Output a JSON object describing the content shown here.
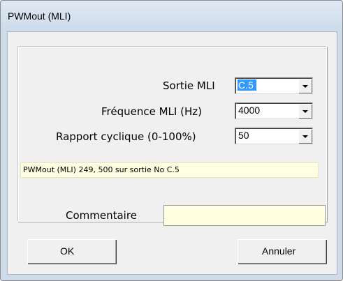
{
  "window": {
    "title": "PWMout (MLI)"
  },
  "form": {
    "output": {
      "label": "Sortie MLI",
      "value": "C.5"
    },
    "frequency": {
      "label": "Fréquence MLI (Hz)",
      "value": "4000"
    },
    "duty": {
      "label": "Rapport cyclique (0-100%)",
      "value": "50"
    }
  },
  "status_line": "PWMout (MLI) 249, 500 sur sortie No C.5",
  "comment": {
    "label": "Commentaire",
    "value": ""
  },
  "buttons": {
    "ok": "OK",
    "cancel": "Annuler"
  }
}
